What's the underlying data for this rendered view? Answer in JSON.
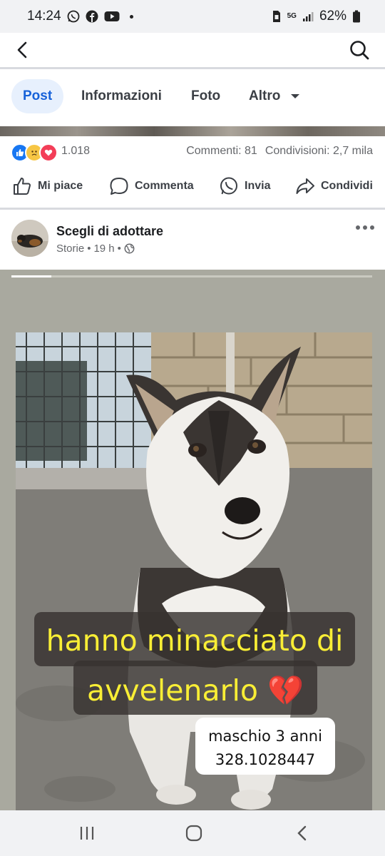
{
  "status_bar": {
    "time": "14:24",
    "network": "5G",
    "battery": "62%"
  },
  "tabs": [
    {
      "label": "Post"
    },
    {
      "label": "Informazioni"
    },
    {
      "label": "Foto"
    },
    {
      "label": "Altro"
    }
  ],
  "reactions": {
    "count": "1.018",
    "comments": "Commenti: 81",
    "shares": "Condivisioni: 2,7 mila"
  },
  "actions": {
    "like": "Mi piace",
    "comment": "Commenta",
    "send": "Invia",
    "share": "Condividi"
  },
  "post": {
    "author": "Scegli di adottare",
    "source": "Storie",
    "time": "19 h"
  },
  "story": {
    "caption_line1": "hanno minacciato di",
    "caption_line2": "avvelenarlo 💔",
    "info_line1": "maschio 3 anni",
    "info_line2": "328.1028447",
    "progress": 0.11
  },
  "colors": {
    "accent": "#1762d9",
    "caption_text": "#f9ee35"
  }
}
